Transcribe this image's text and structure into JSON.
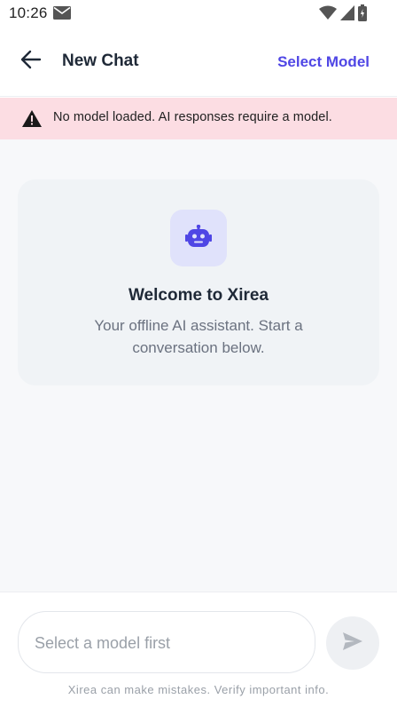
{
  "status_bar": {
    "time": "10:26"
  },
  "header": {
    "title": "New Chat",
    "select_model_label": "Select Model"
  },
  "warning": {
    "text": "No model loaded. AI responses require a model."
  },
  "welcome": {
    "title": "Welcome to Xirea",
    "subtitle": "Your offline AI assistant. Start a conversation below."
  },
  "composer": {
    "placeholder": "Select a model first",
    "value": "",
    "disclaimer": "Xirea can make mistakes. Verify important info."
  },
  "colors": {
    "accent": "#4f46e5",
    "warning_bg": "#fcdde3",
    "chat_bg": "#f7f8fa",
    "card_bg": "#f0f3f6"
  }
}
